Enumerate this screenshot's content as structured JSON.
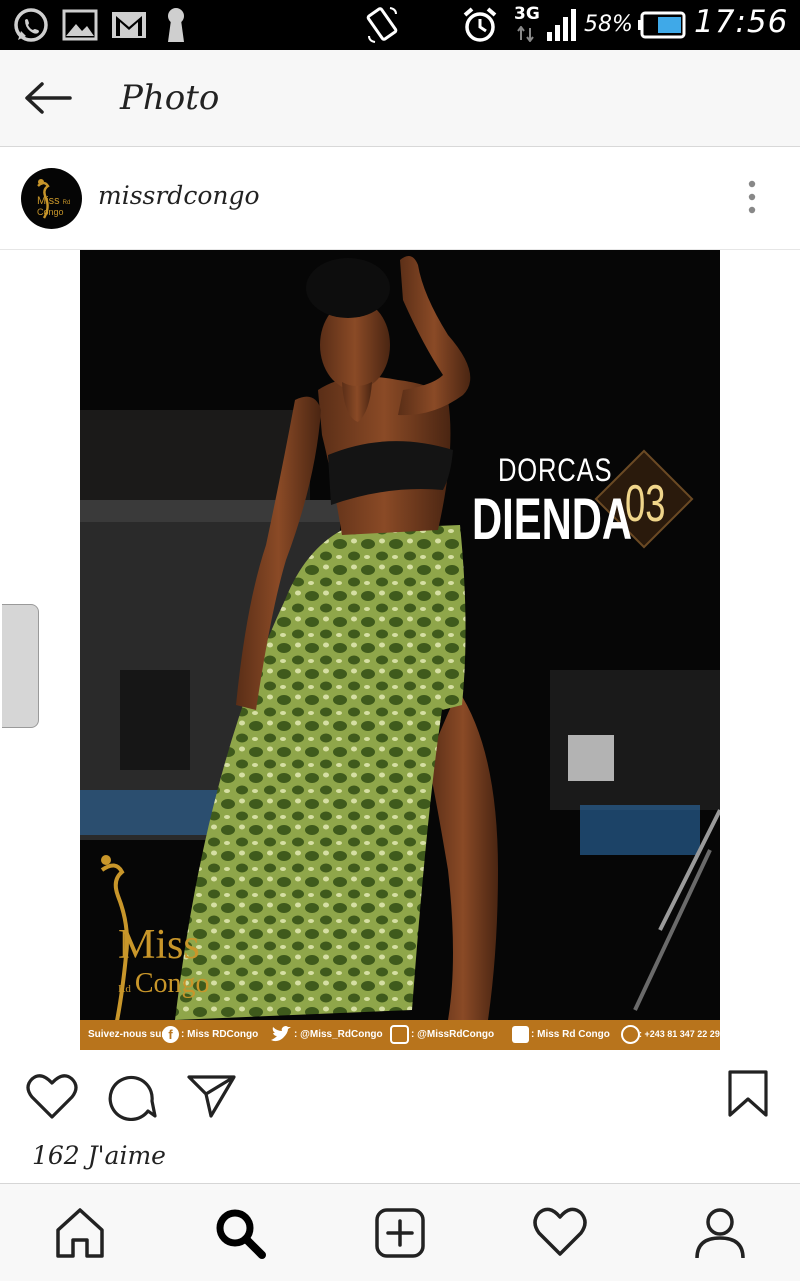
{
  "status_bar": {
    "time": "17:56",
    "battery": "58%",
    "network": "3G",
    "icons": [
      "whatsapp-icon",
      "gallery-icon",
      "gmail-icon",
      "keyhole-icon",
      "screen-rotate-icon",
      "alarm-icon",
      "signal-icon",
      "battery-icon"
    ]
  },
  "header": {
    "title": "Photo",
    "back_icon": "arrow-left-icon"
  },
  "post": {
    "username": "missrdcongo",
    "more_icon": "vertical-dots-icon",
    "avatar_text": [
      "Miss",
      "Rd",
      "Congo"
    ]
  },
  "photo": {
    "first_name": "DORCAS",
    "last_name": "DIENDA",
    "number": "03",
    "logo_text": [
      "Miss",
      "Rd",
      "Congo"
    ],
    "footer": {
      "follow": "Suivez-nous sur",
      "facebook": ": Miss RDCongo",
      "twitter": ": @Miss_RdCongo",
      "instagram": ": @MissRdCongo",
      "youtube": ": Miss Rd Congo",
      "whatsapp": ": +243 81 347 22 29"
    }
  },
  "actions": {
    "likes": "162 J'aime"
  },
  "bottom_nav": {
    "items": [
      "home-icon",
      "search-icon",
      "add-post-icon",
      "activity-heart-icon",
      "profile-icon"
    ]
  },
  "colors": {
    "gold": "#c8962a",
    "footer_bg": "#b8741c",
    "skirt_green": "#7e9a3e"
  }
}
